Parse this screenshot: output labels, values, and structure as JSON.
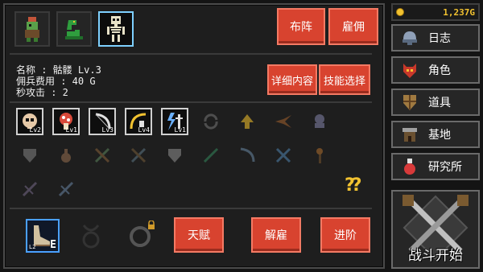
{
  "roster": {
    "units": [
      {
        "name": "goblin-unit",
        "selected": false
      },
      {
        "name": "serpent-unit",
        "selected": false
      },
      {
        "name": "skeleton-unit",
        "selected": true
      }
    ],
    "formation_label": "布阵",
    "hire_label": "雇佣"
  },
  "unit": {
    "name_line": "名称 : 骷髅 Lv.3",
    "cost_line": "佣兵费用 : 40 G",
    "dps_line": "秒攻击 : 2"
  },
  "detail_buttons": {
    "details_label": "详细内容",
    "skill_select_label": "技能选择"
  },
  "skills": [
    {
      "icon": "skull-skill-icon",
      "lv": "Lv2",
      "owned": true
    },
    {
      "icon": "mushroom-skill-icon",
      "lv": "Lv1",
      "owned": true
    },
    {
      "icon": "bow-skill-icon",
      "lv": "Lv3",
      "owned": true
    },
    {
      "icon": "arc-skill-icon",
      "lv": "Lv4",
      "owned": true
    },
    {
      "icon": "lightning-sword-skill-icon",
      "lv": "Lv1",
      "owned": true
    },
    {
      "icon": "cycle-skill-icon",
      "lv": "",
      "owned": false
    },
    {
      "icon": "arrow-up-skill-icon",
      "lv": "",
      "owned": false
    },
    {
      "icon": "burst-skill-icon",
      "lv": "",
      "owned": false
    },
    {
      "icon": "ghost-skill-icon",
      "lv": "",
      "owned": false
    },
    {
      "icon": "shield-skill-icon",
      "lv": "",
      "owned": false
    },
    {
      "icon": "potion-skill-icon",
      "lv": "",
      "owned": false
    },
    {
      "icon": "sword-skill-icon",
      "lv": "",
      "owned": false
    },
    {
      "icon": "sword-skill-icon",
      "lv": "",
      "owned": false
    },
    {
      "icon": "shield-skill-icon",
      "lv": "",
      "owned": false
    },
    {
      "icon": "sword-skill-icon",
      "lv": "",
      "owned": false
    },
    {
      "icon": "bow-skill-icon",
      "lv": "",
      "owned": false
    },
    {
      "icon": "sword-skill-icon",
      "lv": "",
      "owned": false
    },
    {
      "icon": "torch-skill-icon",
      "lv": "",
      "owned": false
    },
    {
      "icon": "crossbow-skill-icon",
      "lv": "",
      "owned": false
    },
    {
      "icon": "crossbow-skill-icon",
      "lv": "",
      "owned": false
    }
  ],
  "help_text": "??",
  "equipment": [
    {
      "icon": "boot-equip-icon",
      "tag": "E",
      "level": "L2",
      "state": "equipped"
    },
    {
      "icon": "amulet-equip-icon",
      "tag": "",
      "level": "",
      "state": "empty"
    },
    {
      "icon": "ring-equip-icon",
      "tag": "",
      "level": "",
      "state": "locked"
    }
  ],
  "actions": {
    "talent_label": "天赋",
    "dismiss_label": "解雇",
    "advance_label": "进阶"
  },
  "gold": {
    "value": "1,237G"
  },
  "menu": [
    {
      "icon": "helmet-icon",
      "label": "日志"
    },
    {
      "icon": "demon-mask-icon",
      "label": "角色"
    },
    {
      "icon": "shield-item-icon",
      "label": "道具"
    },
    {
      "icon": "base-icon",
      "label": "基地"
    },
    {
      "icon": "potion-icon",
      "label": "研究所"
    }
  ],
  "battle": {
    "label": "战斗开始"
  },
  "colors": {
    "accent_red": "#d8432f",
    "gold": "#f2c230",
    "selected_border": "#7ed0ff"
  }
}
